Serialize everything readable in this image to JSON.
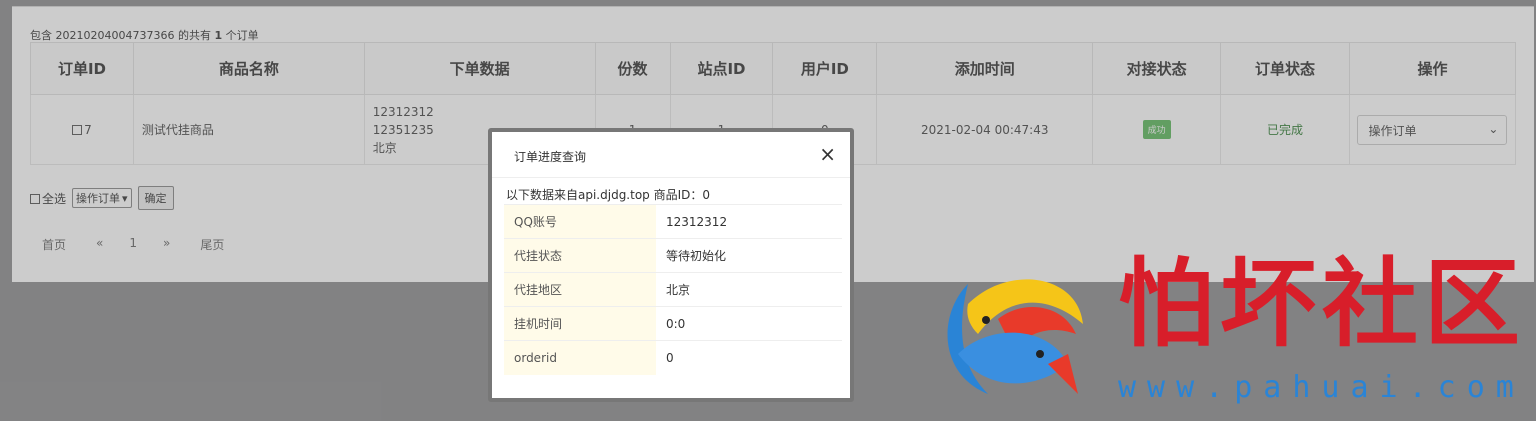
{
  "summary": {
    "prefix": "包含 20210204004737366 的共有 ",
    "count": "1",
    "suffix": " 个订单"
  },
  "table": {
    "headers": [
      "订单ID",
      "商品名称",
      "下单数据",
      "份数",
      "站点ID",
      "用户ID",
      "添加时间",
      "对接状态",
      "订单状态",
      "操作"
    ],
    "row": {
      "id": "7",
      "product": "测试代挂商品",
      "data_lines": [
        "12312312",
        "12351235",
        "北京"
      ],
      "qty": "1",
      "site_id": "1",
      "user_id": "0",
      "added": "2021-02-04 00:47:43",
      "dock_status": "成功",
      "order_status": "已完成",
      "action_select": "操作订单"
    }
  },
  "bulk": {
    "select_all": "全选",
    "action": "操作订单",
    "confirm": "确定"
  },
  "pager": [
    "首页",
    "«",
    "1",
    "»",
    "尾页"
  ],
  "modal": {
    "title": "订单进度查询",
    "close": "×",
    "source": "以下数据来自api.djdg.top 商品ID：0",
    "rows": [
      {
        "k": "QQ账号",
        "v": "12312312"
      },
      {
        "k": "代挂状态",
        "v": "等待初始化"
      },
      {
        "k": "代挂地区",
        "v": "北京"
      },
      {
        "k": "挂机时间",
        "v": "0:0"
      },
      {
        "k": "orderid",
        "v": "0"
      }
    ]
  },
  "watermark": {
    "brand": "怕坏社区",
    "url": "www.pahuai.com"
  },
  "colors": {
    "success_badge": "#5cb85c",
    "brand_red": "#d81e2a",
    "brand_blue": "#2a84d6"
  }
}
